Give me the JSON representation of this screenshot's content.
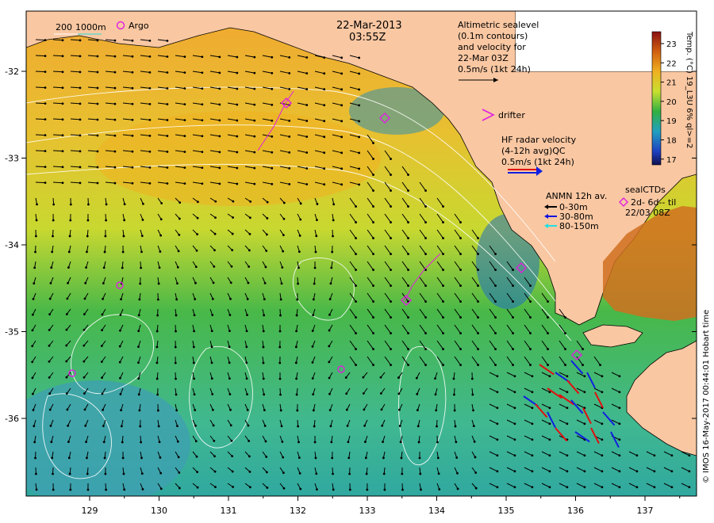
{
  "title": {
    "date": "22-Mar-2013",
    "time": "03:55Z"
  },
  "scale_labels": {
    "depth_200": "200",
    "depth_1000": "1000m",
    "argo": "Argo"
  },
  "altimetry": {
    "line1": "Altimetric sealevel",
    "line2": "(0.1m contours)",
    "line3": "and velocity for",
    "line4": "22-Mar 03Z",
    "line5": "0.5m/s (1kt 24h)"
  },
  "drifter": {
    "label": "drifter"
  },
  "hf_radar": {
    "line1": "HF radar velocity",
    "line2": "(4-12h avg)QC",
    "line3": "0.5m/s (1kt 24h)"
  },
  "anmn": {
    "title": "ANMN 12h av.",
    "items": [
      {
        "label": "0-30m",
        "color": "#000000"
      },
      {
        "label": "30-80m",
        "color": "#1010e0"
      },
      {
        "label": "80-150m",
        "color": "#20e0e0"
      }
    ]
  },
  "sealctd": {
    "title": "sealCTDs",
    "line2": "2d- 6d-- til",
    "line3": "22/03 08Z"
  },
  "colorbar": {
    "label": "Temp. (°C) 19_L3U 6% ql>=2",
    "ticks": [
      "23",
      "22",
      "21",
      "20",
      "19",
      "18",
      "17"
    ]
  },
  "credit": "© IMOS 16-May-2017 00:44:01 Hobart time",
  "axes": {
    "x_ticks": [
      "129",
      "130",
      "131",
      "132",
      "133",
      "134",
      "135",
      "136",
      "137"
    ],
    "y_ticks": [
      "-32",
      "-33",
      "-34",
      "-35",
      "-36"
    ]
  },
  "colors": {
    "land": "#f9c7a2",
    "argo": "#e020e0",
    "hf_radar_red": "#e01010",
    "hf_radar_blue": "#1020e0"
  }
}
